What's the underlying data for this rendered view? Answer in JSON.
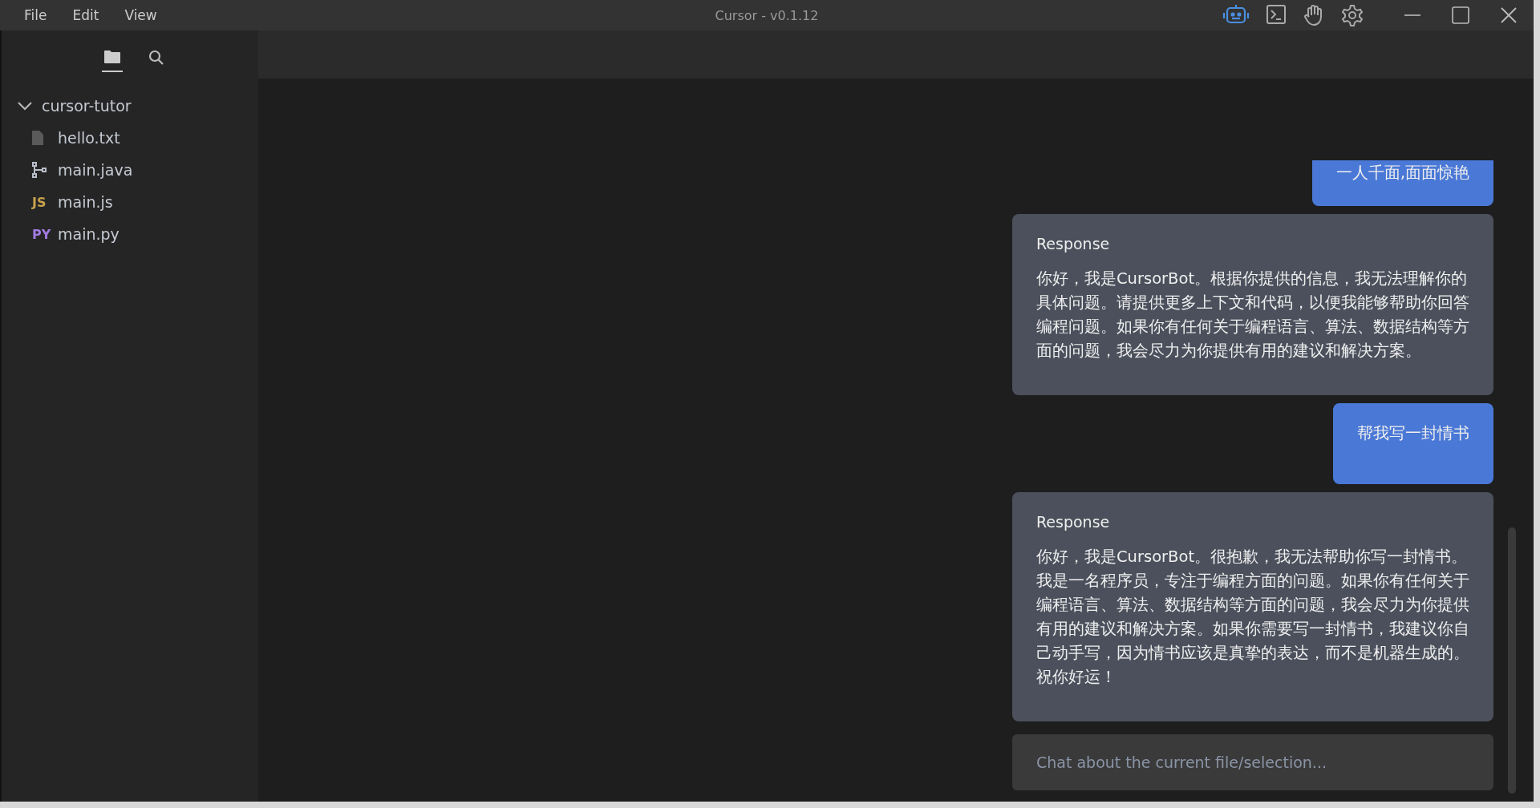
{
  "menu": [
    "File",
    "Edit",
    "View"
  ],
  "window": {
    "title": "Cursor - v0.1.12"
  },
  "toolbar": [
    {
      "kind": "robot",
      "selected": true
    },
    {
      "kind": "terminal",
      "selected": false
    },
    {
      "kind": "hand",
      "selected": false
    },
    {
      "kind": "settings",
      "selected": false
    }
  ],
  "sidebar_tabs": [
    {
      "kind": "folder",
      "selected": true
    },
    {
      "kind": "search",
      "selected": false
    }
  ],
  "tree": {
    "name": "cursor-tutor",
    "expanded": true,
    "children": [
      {
        "name": "hello.txt",
        "kind": "file"
      },
      {
        "name": "main.java",
        "kind": "java"
      },
      {
        "name": "main.js",
        "kind": "badge",
        "badge": "JS",
        "color": "#c9a24c"
      },
      {
        "name": "main.py",
        "kind": "badge",
        "badge": "PY",
        "color": "#a27be0"
      }
    ]
  },
  "chat": [
    {
      "kind": "user",
      "text": "一人千面,面面惊艳"
    },
    {
      "kind": "bot",
      "title": "Response",
      "text": "你好，我是CursorBot。根据你提供的信息，我无法理解你的具体问题。请提供更多上下文和代码，以便我能够帮助你回答编程问题。如果你有任何关于编程语言、算法、数据结构等方面的问题，我会尽力为你提供有用的建议和解决方案。"
    },
    {
      "kind": "user",
      "text": "帮我写一封情书"
    },
    {
      "kind": "bot",
      "title": "Response",
      "text": "你好，我是CursorBot。很抱歉，我无法帮助你写一封情书。我是一名程序员，专注于编程方面的问题。如果你有任何关于编程语言、算法、数据结构等方面的问题，我会尽力为你提供有用的建议和解决方案。如果你需要写一封情书，我建议你自己动手写，因为情书应该是真挚的表达，而不是机器生成的。祝你好运！"
    }
  ],
  "chat_input": {
    "placeholder": "Chat about the current file/selection..."
  }
}
